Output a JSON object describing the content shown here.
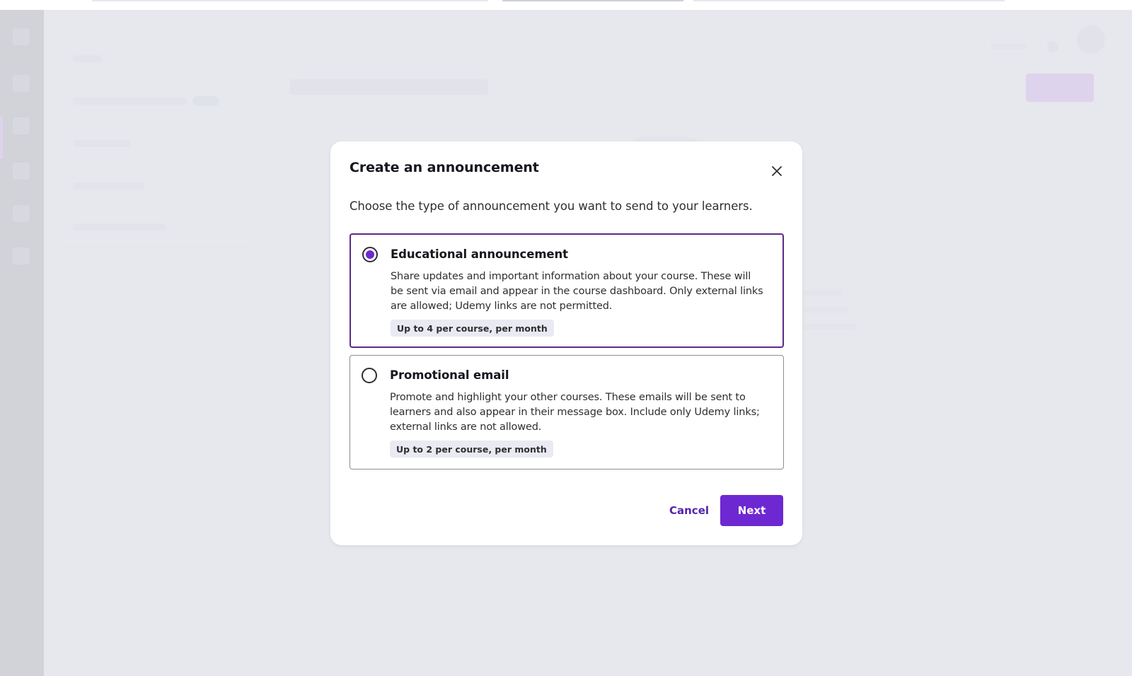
{
  "modal": {
    "title": "Create an announcement",
    "description": "Choose the type of announcement you want to send to your learners.",
    "close_icon": "close-icon",
    "options": [
      {
        "title": "Educational announcement",
        "description": "Share updates and important information about your course. These will be sent via email and appear in the course dashboard. Only external links are allowed; Udemy links are not permitted.",
        "limit": "Up to 4 per course, per month",
        "selected": true
      },
      {
        "title": "Promotional email",
        "description": "Promote and highlight your other courses. These emails will be sent to learners and also appear in their message box. Include only Udemy links; external links are not allowed.",
        "limit": "Up to 2 per course, per month",
        "selected": false
      }
    ],
    "cancel_label": "Cancel",
    "next_label": "Next"
  },
  "colors": {
    "primary": "#6d28d2",
    "selected_border": "#5b2a86",
    "cancel_text": "#5624a8",
    "badge_bg": "#e9eaf2",
    "overlay": "#e4e4ec"
  }
}
